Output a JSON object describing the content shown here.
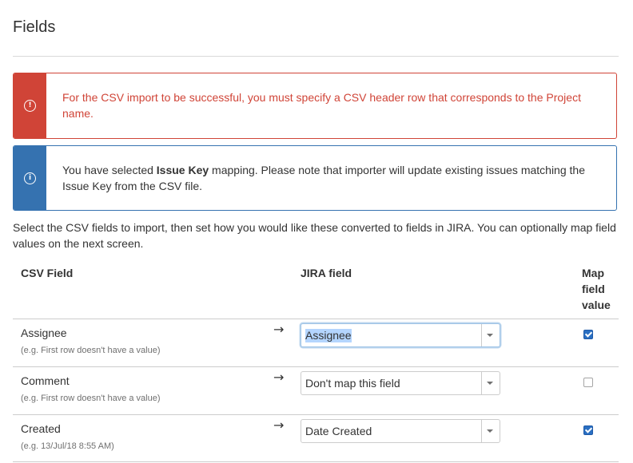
{
  "page": {
    "title": "Fields"
  },
  "alerts": {
    "error": {
      "icon": "error-icon",
      "message": "For the CSV import to be successful, you must specify a CSV header row that corresponds to the Project name."
    },
    "info": {
      "icon": "info-icon",
      "prefix": "You have selected ",
      "bold": "Issue Key",
      "suffix": " mapping. Please note that importer will update existing issues matching the Issue Key from the CSV file."
    }
  },
  "intro": "Select the CSV fields to import, then set how you would like these converted to fields in JIRA. You can optionally map field values on the next screen.",
  "table": {
    "headers": {
      "csv_field": "CSV Field",
      "jira_field": "JIRA field",
      "map_value": "Map field value"
    },
    "rows": [
      {
        "csv_field": "Assignee",
        "example": "(e.g. First row doesn't have a value)",
        "arrow": "→",
        "jira_field": "Assignee",
        "focused": true,
        "map_value": true
      },
      {
        "csv_field": "Comment",
        "example": "(e.g. First row doesn't have a value)",
        "arrow": "→",
        "jira_field": "Don't map this field",
        "focused": false,
        "map_value": false
      },
      {
        "csv_field": "Created",
        "example": "(e.g. 13/Jul/18 8:55 AM)",
        "arrow": "→",
        "jira_field": "Date Created",
        "focused": false,
        "map_value": true
      }
    ]
  },
  "colors": {
    "error": "#d04437",
    "info": "#3572b0",
    "checkbox_checked": "#2a6fc2"
  }
}
